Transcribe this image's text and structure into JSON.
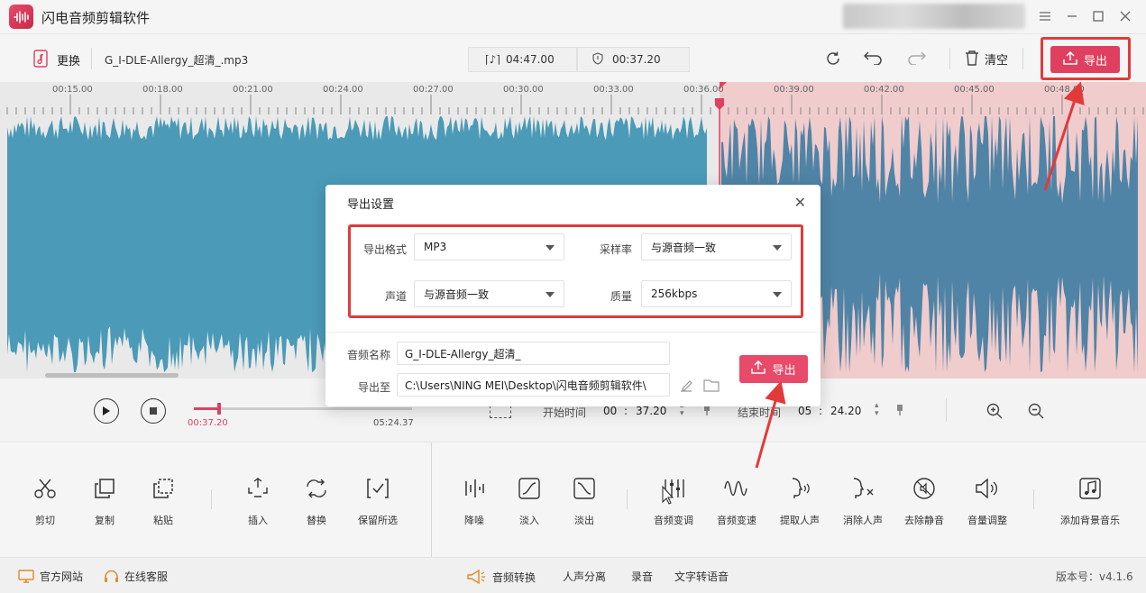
{
  "app": {
    "title": "闪电音频剪辑软件"
  },
  "toolbar": {
    "replace_label": "更换",
    "file_name": "G_I-DLE-Allergy_超清_.mp3",
    "total_duration": "04:47.00",
    "selected_duration": "00:37.20",
    "clear_label": "清空",
    "export_label": "导出"
  },
  "timeline": {
    "ticks": [
      "00:15.00",
      "00:18.00",
      "00:21.00",
      "00:24.00",
      "00:27.00",
      "00:30.00",
      "00:33.00",
      "00:36.00",
      "00:39.00",
      "00:42.00",
      "00:45.00",
      "00:48.00"
    ]
  },
  "playback": {
    "current_time": "00:37.20",
    "total_time": "05:24.37",
    "progress": 0.115,
    "start_label": "开始时间",
    "start_min": "00",
    "start_sec": "37.20",
    "end_label": "结束时间",
    "end_min": "05",
    "end_sec": "24.20"
  },
  "tools": [
    {
      "label": "剪切",
      "icon": "scissors-icon"
    },
    {
      "label": "复制",
      "icon": "copy-icon"
    },
    {
      "label": "粘贴",
      "icon": "paste-icon"
    },
    {
      "label": "插入",
      "icon": "insert-icon"
    },
    {
      "label": "替换",
      "icon": "replace-icon"
    },
    {
      "label": "保留所选",
      "icon": "keep-selection-icon"
    },
    {
      "label": "降噪",
      "icon": "denoise-icon"
    },
    {
      "label": "淡入",
      "icon": "fade-in-icon"
    },
    {
      "label": "淡出",
      "icon": "fade-out-icon"
    },
    {
      "label": "音频变调",
      "icon": "pitch-icon"
    },
    {
      "label": "音频变速",
      "icon": "speed-icon"
    },
    {
      "label": "提取人声",
      "icon": "extract-voice-icon"
    },
    {
      "label": "消除人声",
      "icon": "remove-voice-icon"
    },
    {
      "label": "去除静音",
      "icon": "remove-silence-icon"
    },
    {
      "label": "音量调整",
      "icon": "volume-icon"
    },
    {
      "label": "添加背景音乐",
      "icon": "background-music-icon"
    }
  ],
  "statusbar": {
    "official_site": "官方网站",
    "online_service": "在线客服",
    "audio_convert": "音频转换",
    "voice_separate": "人声分离",
    "record": "录音",
    "tts": "文字转语音",
    "version": "版本号：v4.1.6"
  },
  "dialog": {
    "title": "导出设置",
    "format_label": "导出格式",
    "format_value": "MP3",
    "samplerate_label": "采样率",
    "samplerate_value": "与源音频一致",
    "channel_label": "声道",
    "channel_value": "与源音频一致",
    "quality_label": "质量",
    "quality_value": "256kbps",
    "name_label": "音频名称",
    "name_value": "G_I-DLE-Allergy_超清_",
    "path_label": "导出至",
    "path_value": "C:\\Users\\NING MEI\\Desktop\\闪电音频剪辑软件\\",
    "export_label": "导出"
  },
  "colors": {
    "accent": "#e0405f",
    "wave": "#4a9ab8",
    "wave_selected": "#4f84a6",
    "selection_bg": "#f0c9cc",
    "highlight_box": "#e23a3a"
  }
}
